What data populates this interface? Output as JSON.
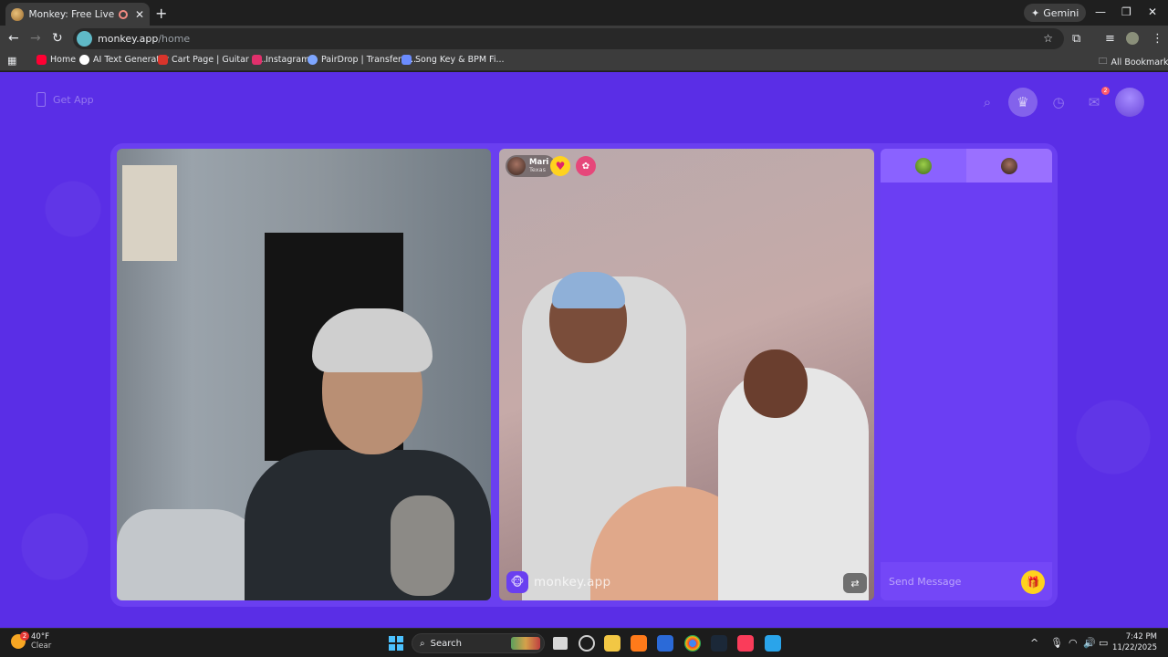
{
  "browser": {
    "tab_title": "Monkey: Free Live Video Ch",
    "new_tab_symbol": "+",
    "gemini_label": "Gemini",
    "url_host": "monkey.app",
    "url_path": "/home",
    "bookmarks": [
      {
        "label": "Home",
        "icon": "youtube-icon",
        "color": "#ff0033"
      },
      {
        "label": "AI Text Generator",
        "icon": "ai-icon",
        "color": "#ffffff"
      },
      {
        "label": "Cart Page | Guitar C...",
        "icon": "cart-icon",
        "color": "#d9342b"
      },
      {
        "label": "Instagram",
        "icon": "instagram-icon",
        "color": "#e1306c"
      },
      {
        "label": "PairDrop | Transfer F...",
        "icon": "pairdrop-icon",
        "color": "#7ea6ff"
      },
      {
        "label": "Song Key & BPM Fi...",
        "icon": "note-icon",
        "color": "#6b8cff"
      }
    ],
    "all_bookmarks_label": "All Bookmarks"
  },
  "page": {
    "get_app_label": "Get App",
    "notification_count": "2",
    "accent": "#5a2ee6"
  },
  "remote_user": {
    "name": "Mari",
    "location": "Texas"
  },
  "video": {
    "brand_label": "monkey.app"
  },
  "chat": {
    "placeholder": "Send Message"
  },
  "taskbar": {
    "temperature": "40°F",
    "condition": "Clear",
    "weather_badge": "2",
    "search_label": "Search",
    "time": "7:42 PM",
    "date": "11/22/2025"
  }
}
